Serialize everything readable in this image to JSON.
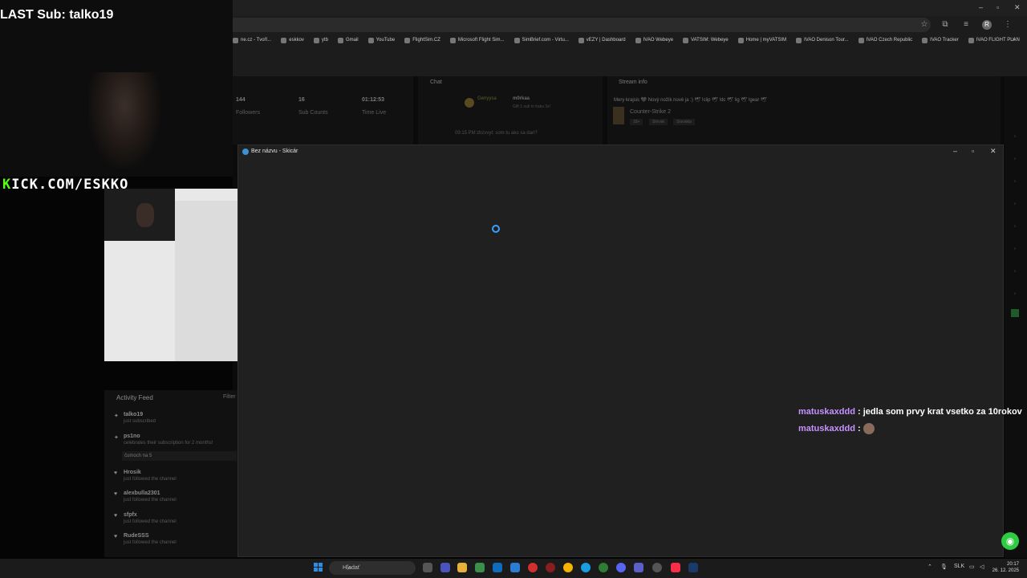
{
  "overlay": {
    "last_sub": "LAST Sub: talko19",
    "kick_prefix": "K",
    "kick_url": "ICK.COM/ESKKO"
  },
  "browser": {
    "bookmarks": [
      "ne.cz - Tvoří...",
      "eskkov",
      "ytb",
      "Gmail",
      "YouTube",
      "FlightSim.CZ",
      "Microsoft Flight Sim...",
      "SimBrief.com - Virtu...",
      "vEZY | Dashboard",
      "IVAO Webeye",
      "VATSIM: Webeye",
      "Home | myVATSIM",
      "IVAO Denison Tour...",
      "IVAO Czech Republic",
      "IVAO Tracker",
      "IVAO FLIGHT PLAN"
    ],
    "profile_letter": "R"
  },
  "dashboard": {
    "stats": [
      {
        "value": "144",
        "label": "Followers"
      },
      {
        "value": "16",
        "label": "Sub Counts"
      },
      {
        "value": "01:12:53",
        "label": "Time Live"
      }
    ],
    "chat_title": "Chat",
    "chat_user1": "Genyysa",
    "chat_user2": "m0rkaa",
    "chat_gift": "Gift 1 sub to kaka 3x!",
    "chat_msg_time": "09:15 PM",
    "chat_msg": "zbzvvyt: som tu ako sa dari?",
    "stream_info_title": "Stream info",
    "stream_title": "Mery krajsis 🖤 Nový nožík nové ja :) 🕊 !clip 🕊 !dc 🕊 !ig 🕊 !gear 🕊",
    "game": "Counter-Strike 2",
    "tags": [
      "18+",
      "Slovak",
      "Slovakia"
    ]
  },
  "activity_feed": {
    "title": "Activity Feed",
    "filter": "Filter",
    "items": [
      {
        "name": "talko19",
        "desc": "just subscribed"
      },
      {
        "name": "ps1no",
        "desc": "celebrates their subscription for 2 months!"
      },
      {
        "name": "Hrosik",
        "desc": "just followed the channel"
      },
      {
        "name": "alexbulla2301",
        "desc": "just followed the channel"
      },
      {
        "name": "sfpfx",
        "desc": "just followed the channel"
      },
      {
        "name": "RudeSSS",
        "desc": "just followed the channel"
      }
    ],
    "message": "čumoch na 5"
  },
  "paint": {
    "title": "Bez názvu - Skicár"
  },
  "chat_overlay": [
    {
      "user": "matuskaxddd",
      "text": "jedla som prvy krat vsetko za 10rokov"
    },
    {
      "user": "matuskaxddd",
      "text": ""
    }
  ],
  "taskbar": {
    "search_placeholder": "Hľadať",
    "lang": "SLK",
    "time": "20:17",
    "date": "26. 12. 2025"
  }
}
